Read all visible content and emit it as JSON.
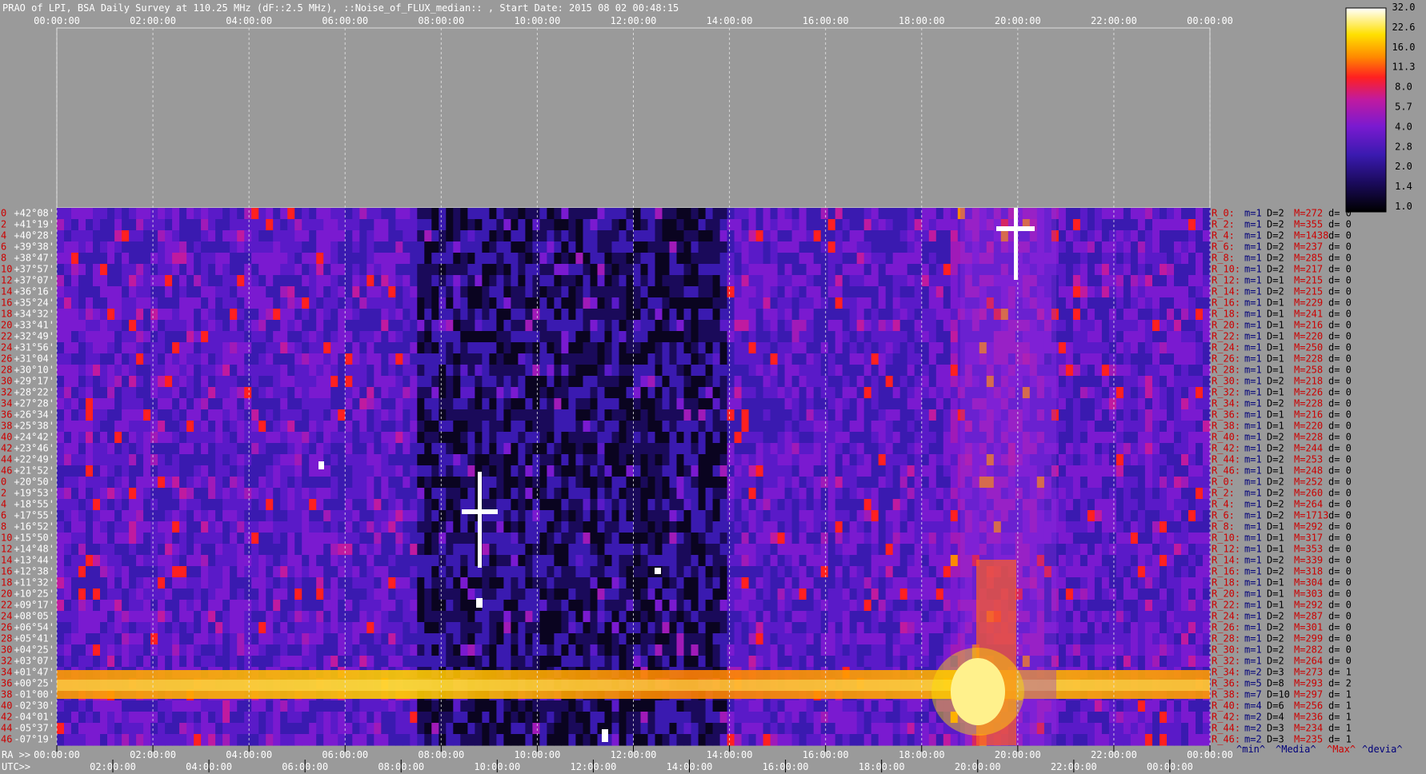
{
  "title": "PRAO of LPI, BSA Daily Survey at 110.25 MHz (dF::2.5 MHz), ::Noise_of_FLUX_median:: , Start Date: 2015 08 02 00:48:15",
  "colors": {
    "background": "#9a9a9a",
    "colormap": [
      "#000000",
      "#1a0a5a",
      "#3a1ab0",
      "#7a1ad0",
      "#c01aa0",
      "#ff2020",
      "#ff8a00",
      "#ffe000",
      "#ffffff"
    ],
    "label_red": "#cc0000",
    "label_blue": "#00007a",
    "text": "#ffffff"
  },
  "chart_data": {
    "type": "heatmap",
    "title": "PRAO of LPI, BSA Daily Survey at 110.25 MHz (dF::2.5 MHz), ::Noise_of_FLUX_median:: , Start Date: 2015 08 02 00:48:15",
    "top_axis_ticks": [
      "00:00:00",
      "02:00:00",
      "04:00:00",
      "06:00:00",
      "08:00:00",
      "10:00:00",
      "12:00:00",
      "14:00:00",
      "16:00:00",
      "18:00:00",
      "20:00:00",
      "22:00:00",
      "00:00:00"
    ],
    "ra_axis_label": "RA >>",
    "ra_axis_ticks": [
      "00:00:00",
      "02:00:00",
      "04:00:00",
      "06:00:00",
      "08:00:00",
      "10:00:00",
      "12:00:00",
      "14:00:00",
      "16:00:00",
      "18:00:00",
      "20:00:00",
      "22:00:00",
      "00:00:00"
    ],
    "utc_axis_label": "UTC>>",
    "utc_axis_ticks": [
      "02:00:00",
      "04:00:00",
      "06:00:00",
      "08:00:00",
      "10:00:00",
      "12:00:00",
      "14:00:00",
      "16:00:00",
      "18:00:00",
      "20:00:00",
      "22:00:00",
      "00:00:00"
    ],
    "colorbar_ticks": [
      "32.0",
      "22.6",
      "16.0",
      "11.3",
      "8.0",
      "5.7",
      "4.0",
      "2.8",
      "2.0",
      "1.4",
      "1.0"
    ],
    "legend": {
      "min": "^min^",
      "median": "^Media^",
      "max": "^Max^",
      "dev": "^devia^"
    },
    "beam_numbers": [
      "0",
      "2",
      "4",
      "6",
      "8",
      "10",
      "12",
      "14",
      "16",
      "18",
      "20",
      "22",
      "24",
      "26",
      "28",
      "30",
      "32",
      "34",
      "36",
      "38",
      "40",
      "42",
      "44",
      "46",
      "0",
      "2",
      "4",
      "6",
      "8",
      "10",
      "12",
      "14",
      "16",
      "18",
      "20",
      "22",
      "24",
      "26",
      "28",
      "30",
      "32",
      "34",
      "36",
      "38",
      "40",
      "42",
      "44",
      "46"
    ],
    "declinations": [
      "+42°08'",
      "+41°19'",
      "+40°28'",
      "+39°38'",
      "+38°47'",
      "+37°57'",
      "+37°07'",
      "+36°16'",
      "+35°24'",
      "+34°32'",
      "+33°41'",
      "+32°49'",
      "+31°56'",
      "+31°04'",
      "+30°10'",
      "+29°17'",
      "+28°22'",
      "+27°28'",
      "+26°34'",
      "+25°38'",
      "+24°42'",
      "+23°46'",
      "+22°49'",
      "+21°52'",
      "+20°50'",
      "+19°53'",
      "+18°55'",
      "+17°55'",
      "+16°52'",
      "+15°50'",
      "+14°48'",
      "+13°44'",
      "+12°38'",
      "+11°32'",
      "+10°25'",
      "+09°17'",
      "+08°05'",
      "+06°54'",
      "+05°41'",
      "+04°25'",
      "+03°07'",
      "+01°47'",
      "+00°25'",
      "-01°00'",
      "-02°30'",
      "-04°01'",
      "-05°37'",
      "-07°19'"
    ],
    "row_stats": [
      {
        "r": "R_0:",
        "m": "m=1",
        "D": "D=2",
        "M": "M=272",
        "d": "d= 0"
      },
      {
        "r": "R_2:",
        "m": "m=1",
        "D": "D=2",
        "M": "M=355",
        "d": "d= 0"
      },
      {
        "r": "R_4:",
        "m": "m=1",
        "D": "D=2",
        "M": "M=1438",
        "d": "d= 0"
      },
      {
        "r": "R_6:",
        "m": "m=1",
        "D": "D=2",
        "M": "M=237",
        "d": "d= 0"
      },
      {
        "r": "R_8:",
        "m": "m=1",
        "D": "D=2",
        "M": "M=285",
        "d": "d= 0"
      },
      {
        "r": "R_10:",
        "m": "m=1",
        "D": "D=2",
        "M": "M=217",
        "d": "d= 0"
      },
      {
        "r": "R_12:",
        "m": "m=1",
        "D": "D=1",
        "M": "M=215",
        "d": "d= 0"
      },
      {
        "r": "R_14:",
        "m": "m=1",
        "D": "D=2",
        "M": "M=215",
        "d": "d= 0"
      },
      {
        "r": "R_16:",
        "m": "m=1",
        "D": "D=1",
        "M": "M=229",
        "d": "d= 0"
      },
      {
        "r": "R_18:",
        "m": "m=1",
        "D": "D=1",
        "M": "M=241",
        "d": "d= 0"
      },
      {
        "r": "R_20:",
        "m": "m=1",
        "D": "D=1",
        "M": "M=216",
        "d": "d= 0"
      },
      {
        "r": "R_22:",
        "m": "m=1",
        "D": "D=1",
        "M": "M=220",
        "d": "d= 0"
      },
      {
        "r": "R_24:",
        "m": "m=1",
        "D": "D=1",
        "M": "M=250",
        "d": "d= 0"
      },
      {
        "r": "R_26:",
        "m": "m=1",
        "D": "D=1",
        "M": "M=228",
        "d": "d= 0"
      },
      {
        "r": "R_28:",
        "m": "m=1",
        "D": "D=1",
        "M": "M=258",
        "d": "d= 0"
      },
      {
        "r": "R_30:",
        "m": "m=1",
        "D": "D=2",
        "M": "M=218",
        "d": "d= 0"
      },
      {
        "r": "R_32:",
        "m": "m=1",
        "D": "D=1",
        "M": "M=226",
        "d": "d= 0"
      },
      {
        "r": "R_34:",
        "m": "m=1",
        "D": "D=2",
        "M": "M=228",
        "d": "d= 0"
      },
      {
        "r": "R_36:",
        "m": "m=1",
        "D": "D=1",
        "M": "M=216",
        "d": "d= 0"
      },
      {
        "r": "R_38:",
        "m": "m=1",
        "D": "D=1",
        "M": "M=220",
        "d": "d= 0"
      },
      {
        "r": "R_40:",
        "m": "m=1",
        "D": "D=2",
        "M": "M=228",
        "d": "d= 0"
      },
      {
        "r": "R_42:",
        "m": "m=1",
        "D": "D=2",
        "M": "M=244",
        "d": "d= 0"
      },
      {
        "r": "R_44:",
        "m": "m=1",
        "D": "D=2",
        "M": "M=253",
        "d": "d= 0"
      },
      {
        "r": "R_46:",
        "m": "m=1",
        "D": "D=1",
        "M": "M=248",
        "d": "d= 0"
      },
      {
        "r": "R_0:",
        "m": "m=1",
        "D": "D=2",
        "M": "M=252",
        "d": "d= 0"
      },
      {
        "r": "R_2:",
        "m": "m=1",
        "D": "D=2",
        "M": "M=260",
        "d": "d= 0"
      },
      {
        "r": "R_4:",
        "m": "m=1",
        "D": "D=2",
        "M": "M=264",
        "d": "d= 0"
      },
      {
        "r": "R_6:",
        "m": "m=1",
        "D": "D=2",
        "M": "M=1713",
        "d": "d= 0"
      },
      {
        "r": "R_8:",
        "m": "m=1",
        "D": "D=1",
        "M": "M=292",
        "d": "d= 0"
      },
      {
        "r": "R_10:",
        "m": "m=1",
        "D": "D=1",
        "M": "M=317",
        "d": "d= 0"
      },
      {
        "r": "R_12:",
        "m": "m=1",
        "D": "D=1",
        "M": "M=353",
        "d": "d= 0"
      },
      {
        "r": "R_14:",
        "m": "m=1",
        "D": "D=2",
        "M": "M=339",
        "d": "d= 0"
      },
      {
        "r": "R_16:",
        "m": "m=1",
        "D": "D=2",
        "M": "M=318",
        "d": "d= 0"
      },
      {
        "r": "R_18:",
        "m": "m=1",
        "D": "D=1",
        "M": "M=304",
        "d": "d= 0"
      },
      {
        "r": "R_20:",
        "m": "m=1",
        "D": "D=1",
        "M": "M=303",
        "d": "d= 0"
      },
      {
        "r": "R_22:",
        "m": "m=1",
        "D": "D=1",
        "M": "M=292",
        "d": "d= 0"
      },
      {
        "r": "R_24:",
        "m": "m=1",
        "D": "D=2",
        "M": "M=287",
        "d": "d= 0"
      },
      {
        "r": "R_26:",
        "m": "m=1",
        "D": "D=2",
        "M": "M=301",
        "d": "d= 0"
      },
      {
        "r": "R_28:",
        "m": "m=1",
        "D": "D=2",
        "M": "M=299",
        "d": "d= 0"
      },
      {
        "r": "R_30:",
        "m": "m=1",
        "D": "D=2",
        "M": "M=282",
        "d": "d= 0"
      },
      {
        "r": "R_32:",
        "m": "m=1",
        "D": "D=2",
        "M": "M=264",
        "d": "d= 0"
      },
      {
        "r": "R_34:",
        "m": "m=2",
        "D": "D=3",
        "M": "M=273",
        "d": "d= 1"
      },
      {
        "r": "R_36:",
        "m": "m=5",
        "D": "D=8",
        "M": "M=293",
        "d": "d= 2"
      },
      {
        "r": "R_38:",
        "m": "m=7",
        "D": "D=10",
        "M": "M=297",
        "d": "d= 1"
      },
      {
        "r": "R_40:",
        "m": "m=4",
        "D": "D=6",
        "M": "M=256",
        "d": "d= 1"
      },
      {
        "r": "R_42:",
        "m": "m=2",
        "D": "D=4",
        "M": "M=236",
        "d": "d= 1"
      },
      {
        "r": "R_44:",
        "m": "m=2",
        "D": "D=3",
        "M": "M=234",
        "d": "d= 1"
      },
      {
        "r": "R_46:",
        "m": "m=2",
        "D": "D=3",
        "M": "M=235",
        "d": "d= 1"
      }
    ]
  }
}
